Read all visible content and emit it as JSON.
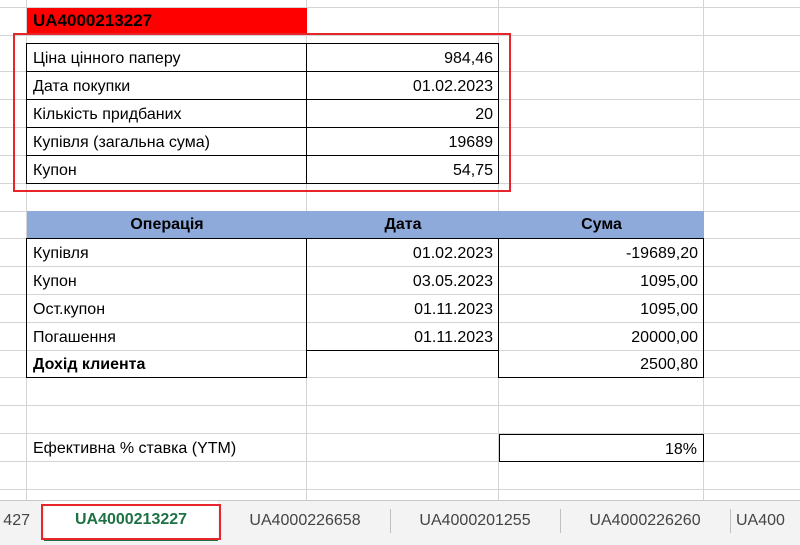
{
  "bond": {
    "header_id": "UA4000213227",
    "props": [
      {
        "label": "Ціна цінного паперу",
        "value": "984,46"
      },
      {
        "label": "Дата покупки",
        "value": "01.02.2023"
      },
      {
        "label": "Кількість придбаних",
        "value": "20"
      },
      {
        "label": "Купівля (загальна сума)",
        "value": "19689"
      },
      {
        "label": "Купон",
        "value": "54,75"
      }
    ]
  },
  "operations": {
    "headers": {
      "operation": "Операція",
      "date": "Дата",
      "amount": "Сума"
    },
    "rows": [
      {
        "operation": "Купівля",
        "date": "01.02.2023",
        "amount": "-19689,20"
      },
      {
        "operation": "Купон",
        "date": "03.05.2023",
        "amount": "1095,00"
      },
      {
        "operation": "Ост.купон",
        "date": "01.11.2023",
        "amount": "1095,00"
      },
      {
        "operation": "Погашення",
        "date": "01.11.2023",
        "amount": "20000,00"
      }
    ],
    "total": {
      "label": "Дохід клиента",
      "amount": "2500,80"
    }
  },
  "ytm": {
    "label": "Ефективна % ставка (YTM)",
    "value": "18%"
  },
  "sheet_tabs": [
    {
      "label": "427",
      "active": false
    },
    {
      "label": "UA4000213227",
      "active": true
    },
    {
      "label": "UA4000226658",
      "active": false
    },
    {
      "label": "UA4000201255",
      "active": false
    },
    {
      "label": "UA4000226260",
      "active": false
    },
    {
      "label": "UA400",
      "active": false
    }
  ],
  "colors": {
    "header_fill": "#ff0000",
    "table_header_fill": "#8eaadb",
    "highlight_box": "#e8252b",
    "active_tab_text": "#1e7145",
    "gridline": "#d4d4d4"
  }
}
